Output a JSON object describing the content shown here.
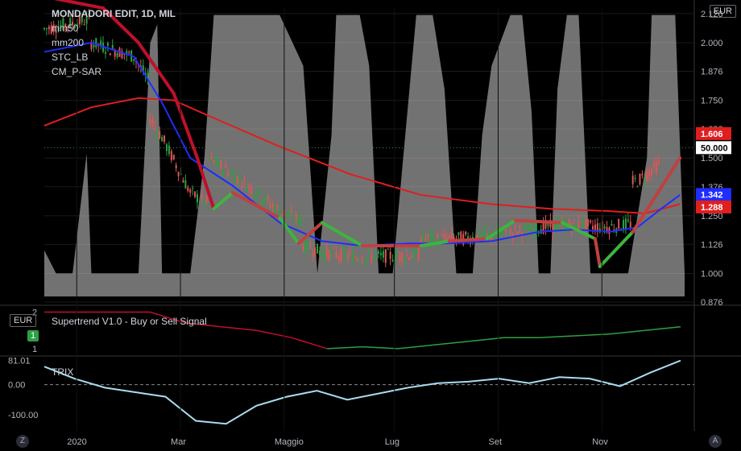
{
  "header": {
    "title": "MONDADORI EDIT, 1D, MIL",
    "currency": "EUR"
  },
  "legend": [
    "mm50",
    "mm200",
    "STC_LB",
    "CM_P-SAR"
  ],
  "colors": {
    "up": "#2ea043",
    "down": "#e05555",
    "ma50": "#1f2dff",
    "ma200": "#e01e1e",
    "supertrend_down": "#c0102a",
    "supertrend_up": "#3db53d",
    "stc": "#d0d0d0",
    "trix": "#a8dcf0",
    "grid": "#1a1a1a"
  },
  "chart_data": [
    {
      "type": "candlestick",
      "title": "MONDADORI EDIT, 1D, MIL",
      "x_ticks": [
        "2020",
        "Mar",
        "Maggio",
        "Lug",
        "Set",
        "Nov"
      ],
      "y_ticks": [
        "2.126",
        "2.000",
        "1.876",
        "1.750",
        "1.626",
        "1.500",
        "1.376",
        "1.250",
        "1.126",
        "1.000",
        "0.876"
      ],
      "ylim": [
        0.876,
        2.15
      ],
      "price_labels": {
        "last": "1.606",
        "ma50": "1.342",
        "ma200": "1.288",
        "stc_value": "50.000"
      },
      "series": [
        {
          "name": "mm50",
          "points": [
            [
              0,
              1.96
            ],
            [
              20,
              2.0
            ],
            [
              38,
              1.94
            ],
            [
              50,
              1.74
            ],
            [
              62,
              1.5
            ],
            [
              80,
              1.38
            ],
            [
              100,
              1.22
            ],
            [
              118,
              1.14
            ],
            [
              135,
              1.12
            ],
            [
              155,
              1.13
            ],
            [
              172,
              1.13
            ],
            [
              190,
              1.14
            ],
            [
              210,
              1.18
            ],
            [
              225,
              1.19
            ],
            [
              240,
              1.18
            ],
            [
              252,
              1.2
            ],
            [
              262,
              1.28
            ],
            [
              270,
              1.34
            ]
          ]
        },
        {
          "name": "mm200",
          "points": [
            [
              0,
              1.64
            ],
            [
              20,
              1.72
            ],
            [
              40,
              1.76
            ],
            [
              55,
              1.75
            ],
            [
              75,
              1.66
            ],
            [
              100,
              1.55
            ],
            [
              130,
              1.43
            ],
            [
              160,
              1.34
            ],
            [
              190,
              1.3
            ],
            [
              215,
              1.28
            ],
            [
              240,
              1.27
            ],
            [
              255,
              1.26
            ],
            [
              270,
              1.3
            ]
          ]
        },
        {
          "name": "Supertrend",
          "points": [
            [
              0,
              2.2
            ],
            [
              25,
              2.15
            ],
            [
              40,
              2.0
            ],
            [
              55,
              1.78
            ],
            [
              65,
              1.5
            ],
            [
              72,
              1.28
            ],
            [
              80,
              1.35
            ],
            [
              100,
              1.24
            ],
            [
              108,
              1.13
            ],
            [
              118,
              1.22
            ],
            [
              135,
              1.12
            ],
            [
              160,
              1.12
            ],
            [
              172,
              1.14
            ],
            [
              188,
              1.15
            ],
            [
              200,
              1.23
            ],
            [
              220,
              1.22
            ],
            [
              234,
              1.15
            ],
            [
              236,
              1.03
            ],
            [
              250,
              1.18
            ],
            [
              270,
              1.5
            ]
          ]
        },
        {
          "name": "STC_LB",
          "points": [
            [
              0,
              1.1
            ],
            [
              5,
              1.0
            ],
            [
              12,
              1.0
            ],
            [
              18,
              1.52
            ],
            [
              20,
              1.0
            ],
            [
              40,
              1.0
            ],
            [
              45,
              2.0
            ],
            [
              48,
              2.08
            ],
            [
              50,
              1.0
            ],
            [
              62,
              1.0
            ],
            [
              68,
              1.5
            ],
            [
              72,
              2.12
            ],
            [
              100,
              2.12
            ],
            [
              110,
              1.9
            ],
            [
              116,
              1.0
            ],
            [
              122,
              1.6
            ],
            [
              124,
              2.12
            ],
            [
              134,
              2.12
            ],
            [
              138,
              1.9
            ],
            [
              142,
              1.0
            ],
            [
              148,
              1.0
            ],
            [
              152,
              1.45
            ],
            [
              158,
              2.12
            ],
            [
              165,
              2.12
            ],
            [
              170,
              1.8
            ],
            [
              175,
              1.0
            ],
            [
              182,
              1.0
            ],
            [
              186,
              1.6
            ],
            [
              190,
              1.9
            ],
            [
              198,
              2.12
            ],
            [
              203,
              2.12
            ],
            [
              207,
              1.7
            ],
            [
              210,
              1.0
            ],
            [
              215,
              1.0
            ],
            [
              218,
              1.8
            ],
            [
              222,
              2.12
            ],
            [
              227,
              2.12
            ],
            [
              232,
              1.0
            ],
            [
              248,
              1.0
            ],
            [
              256,
              1.5
            ],
            [
              258,
              2.12
            ],
            [
              268,
              2.12
            ],
            [
              272,
              1.0
            ]
          ]
        }
      ]
    },
    {
      "type": "line",
      "title": "Supertrend V1.0 - Buy or Sell Signal",
      "y_ticks": [
        "2",
        "1"
      ],
      "ylim": [
        0.8,
        2.1
      ],
      "axis_label": "EUR",
      "badge": "1",
      "series": [
        {
          "name": "Supertrend V1.0 - Buy or Sell Signal",
          "values": [
            2,
            2,
            2,
            2,
            1.7,
            1.6,
            1.5,
            1.3,
            1.0,
            1.05,
            1.0,
            1.1,
            1.2,
            1.3,
            1.3,
            1.35,
            1.4,
            1.5,
            1.6
          ]
        }
      ]
    },
    {
      "type": "line",
      "title": "TRIX",
      "y_ticks": [
        "81.01",
        "0.00",
        "-100.00"
      ],
      "ylim": [
        -140,
        90
      ],
      "series": [
        {
          "name": "TRIX",
          "values": [
            60,
            20,
            -10,
            -25,
            -40,
            -120,
            -130,
            -70,
            -40,
            -20,
            -50,
            -30,
            -10,
            5,
            10,
            20,
            5,
            25,
            20,
            -5,
            40,
            80
          ]
        }
      ]
    }
  ]
}
